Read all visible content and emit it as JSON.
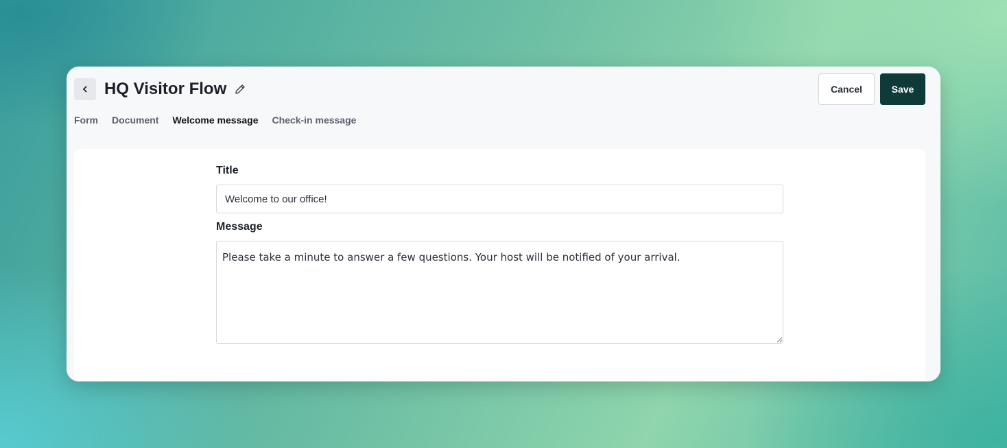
{
  "header": {
    "title": "HQ Visitor Flow",
    "back_icon": "chevron-left-icon",
    "edit_icon": "pencil-icon",
    "cancel_label": "Cancel",
    "save_label": "Save"
  },
  "tabs": [
    {
      "label": "Form",
      "active": false
    },
    {
      "label": "Document",
      "active": false
    },
    {
      "label": "Welcome message",
      "active": true
    },
    {
      "label": "Check-in message",
      "active": false
    }
  ],
  "form": {
    "title_label": "Title",
    "title_value": "Welcome to our office!",
    "message_label": "Message",
    "message_value": "Please take a minute to answer a few questions. Your host will be notified of your arrival."
  },
  "colors": {
    "save_button": "#0f3a3a",
    "window_bg": "#f7f8fa",
    "text_primary": "#1b1f2a"
  }
}
